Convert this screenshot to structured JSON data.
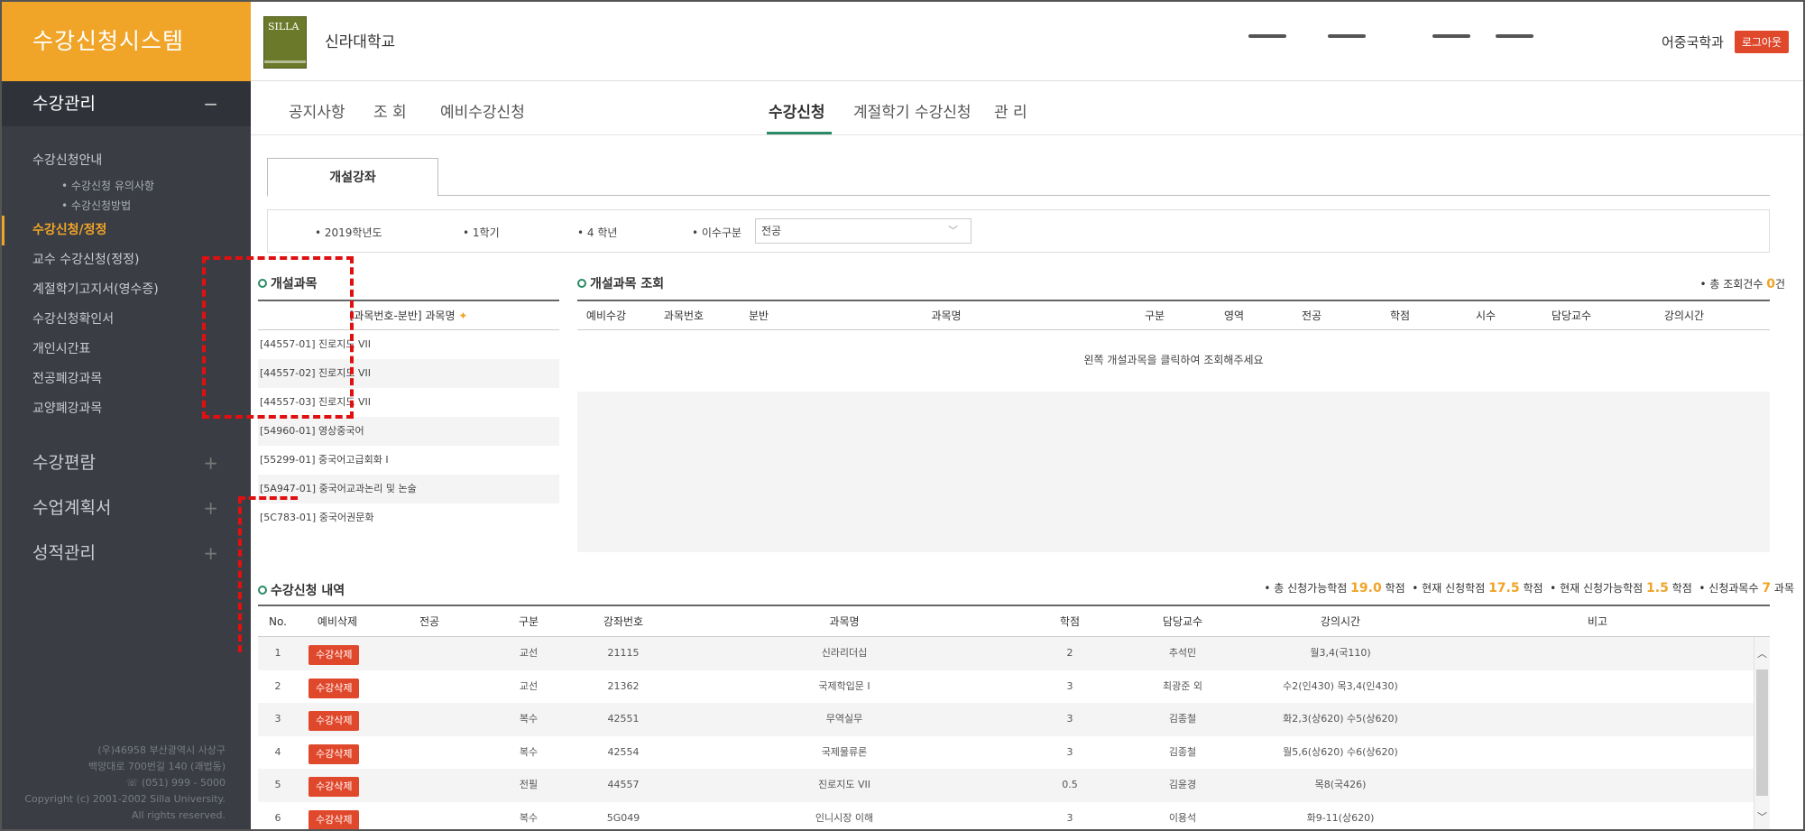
{
  "app": {
    "title": "수강신청시스템",
    "logo_text": "SILLA",
    "university": "신라대학교",
    "department": "어중국학과",
    "logout_label": "로그아웃"
  },
  "sidebar": {
    "sections": [
      {
        "label": "수강관리",
        "sign": "−"
      },
      {
        "label": "수강편람",
        "sign": "+"
      },
      {
        "label": "수업계획서",
        "sign": "+"
      },
      {
        "label": "성적관리",
        "sign": "+"
      }
    ],
    "items": [
      {
        "label": "수강신청안내",
        "level": 1
      },
      {
        "label": "• 수강신청 유의사항",
        "level": 2
      },
      {
        "label": "• 수강신청방법",
        "level": 2
      },
      {
        "label": "수강신청/정정",
        "level": 1,
        "active": true
      },
      {
        "label": "교수 수강신청(정정)",
        "level": 1
      },
      {
        "label": "계절학기고지서(영수증)",
        "level": 1
      },
      {
        "label": "수강신청확인서",
        "level": 1
      },
      {
        "label": "개인시간표",
        "level": 1
      },
      {
        "label": "전공폐강과목",
        "level": 1
      },
      {
        "label": "교양폐강과목",
        "level": 1
      }
    ],
    "copyright": [
      "(우)46958 부산광역시 사상구",
      "백양대로 700번길 140 (괘법동)",
      "☏ (051) 999 - 5000",
      "Copyright (c) 2001-2002 Silla University.",
      "All rights reserved."
    ]
  },
  "topnav": [
    "공지사항",
    "조 회",
    "예비수강신청",
    "수강신청",
    "계절학기 수강신청",
    "관 리"
  ],
  "tab": "개설강좌",
  "filter": {
    "year": "• 2019학년도",
    "semester": "• 1학기",
    "grade": "• 4 학년",
    "category_label": "• 이수구분",
    "category_value": "전공"
  },
  "course_list": {
    "title": "개설과목",
    "header": "[과목번호-분반] 과목명",
    "header_star": "✦",
    "rows": [
      "[44557-01] 진로지도 VII",
      "[44557-02] 진로지도 VII",
      "[44557-03] 진로지도 VII",
      "[54960-01] 영상중국어",
      "[55299-01] 중국어고급회화 I",
      "[5A947-01] 중국어교과논리 및 논술",
      "[5C783-01] 중국어권문화"
    ]
  },
  "open_courses": {
    "title": "개설과목 조회",
    "count_prefix": "• 총 조회건수",
    "count_value": "0",
    "count_suffix": "건",
    "headers": [
      "예비수강",
      "과목번호",
      "분반",
      "과목명",
      "구분",
      "영역",
      "전공",
      "학점",
      "시수",
      "담당교수",
      "강의시간"
    ],
    "empty_message": "왼쪽 개설과목을 클릭하여 조회해주세요"
  },
  "enrollment": {
    "title": "수강신청 내역",
    "summary": {
      "total_label": "• 총 신청가능학점",
      "total_value": "19.0",
      "current_label": "• 현재 신청학점",
      "current_value": "17.5",
      "remaining_label": "• 현재 신청가능학점",
      "remaining_value": "1.5",
      "courses_label": "• 신청과목수",
      "courses_value": "7",
      "unit_credit": "학점",
      "unit_course": "과목"
    },
    "headers": [
      "No.",
      "예비삭제",
      "전공",
      "구분",
      "강좌번호",
      "과목명",
      "학점",
      "담당교수",
      "강의시간",
      "비고"
    ],
    "delete_label": "수강삭제",
    "rows": [
      {
        "no": "1",
        "major": "",
        "type": "교선",
        "code": "21115",
        "name": "신라리더십",
        "credit": "2",
        "prof": "추석민",
        "time": "월3,4(국110)",
        "note": ""
      },
      {
        "no": "2",
        "major": "",
        "type": "교선",
        "code": "21362",
        "name": "국제학입문 I",
        "credit": "3",
        "prof": "최광준 외",
        "time": "수2(인430) 목3,4(인430)",
        "note": ""
      },
      {
        "no": "3",
        "major": "",
        "type": "복수",
        "code": "42551",
        "name": "무역실무",
        "credit": "3",
        "prof": "김종철",
        "time": "화2,3(상620) 수5(상620)",
        "note": ""
      },
      {
        "no": "4",
        "major": "",
        "type": "복수",
        "code": "42554",
        "name": "국제물류론",
        "credit": "3",
        "prof": "김종철",
        "time": "월5,6(상620) 수6(상620)",
        "note": ""
      },
      {
        "no": "5",
        "major": "",
        "type": "전필",
        "code": "44557",
        "name": "진로지도 VII",
        "credit": "0.5",
        "prof": "김윤경",
        "time": "목8(국426)",
        "note": ""
      },
      {
        "no": "6",
        "major": "",
        "type": "복수",
        "code": "5G049",
        "name": "인니시장 이해",
        "credit": "3",
        "prof": "이용석",
        "time": "화9-11(상620)",
        "note": ""
      }
    ]
  },
  "colors": {
    "brand": "#f0a428",
    "sidebar": "#3a3d44",
    "accent_green": "#2c8b66",
    "delete_red": "#e0482c",
    "annotation_red": "#e01010"
  }
}
